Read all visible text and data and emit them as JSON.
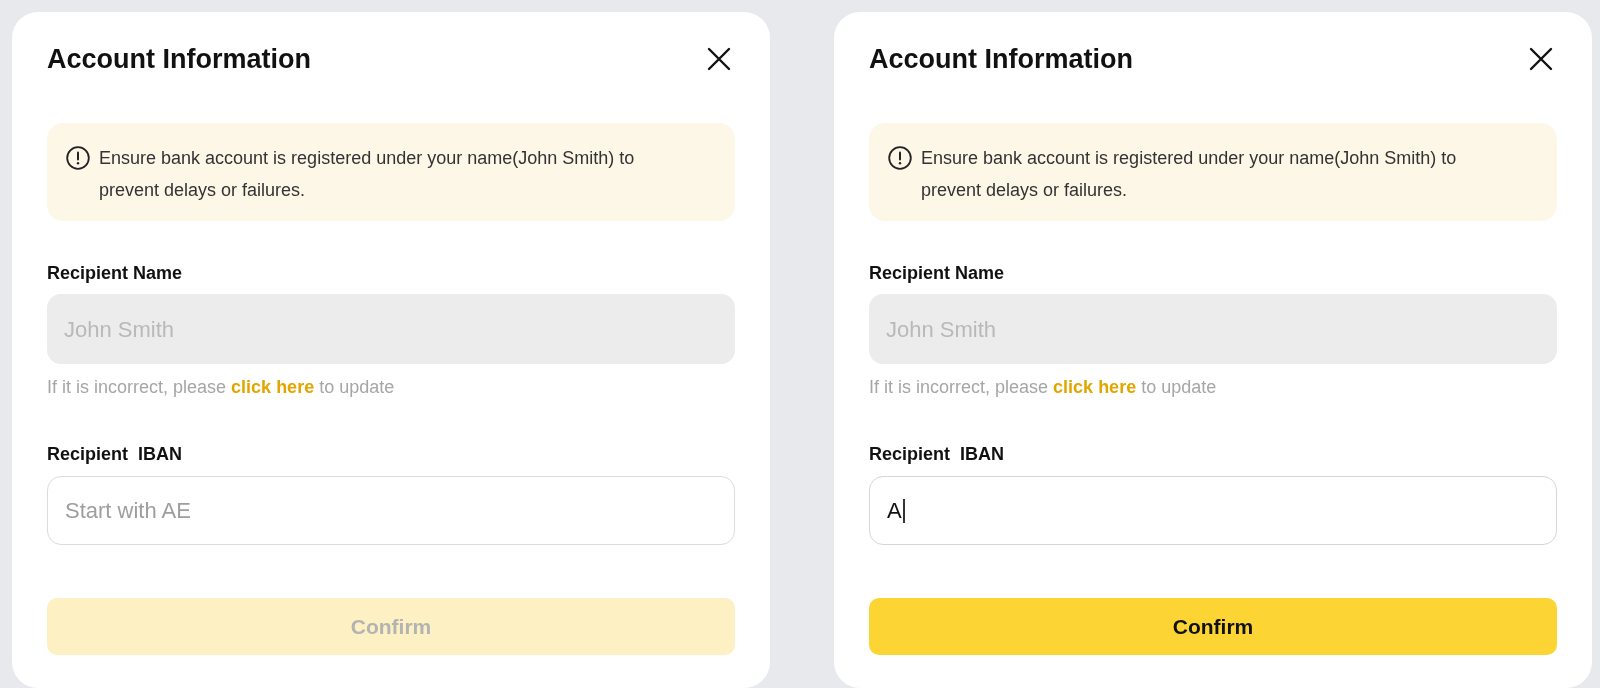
{
  "dialogs": [
    {
      "title": "Account Information",
      "notice": "Ensure bank account is registered under your name(John Smith) to prevent delays or failures.",
      "recipient_name": {
        "label": "Recipient Name",
        "value": "John Smith",
        "disabled": true
      },
      "hint": {
        "before": "If it is incorrect, please",
        "link": "click here",
        "after": "to update"
      },
      "iban": {
        "label": "Recipient  IBAN",
        "placeholder": "Start with AE",
        "focused": false
      },
      "confirm": {
        "label": "Confirm",
        "disabled": true
      }
    },
    {
      "title": "Account Information",
      "notice": "Ensure bank account is registered under your name(John Smith) to prevent delays or failures.",
      "recipient_name": {
        "label": "Recipient Name",
        "value": "John Smith",
        "disabled": true
      },
      "hint": {
        "before": "If it is incorrect, please",
        "link": "click here",
        "after": "to update"
      },
      "iban": {
        "label": "Recipient  IBAN",
        "value": "A",
        "focused": true
      },
      "confirm": {
        "label": "Confirm",
        "disabled": false
      }
    }
  ]
}
